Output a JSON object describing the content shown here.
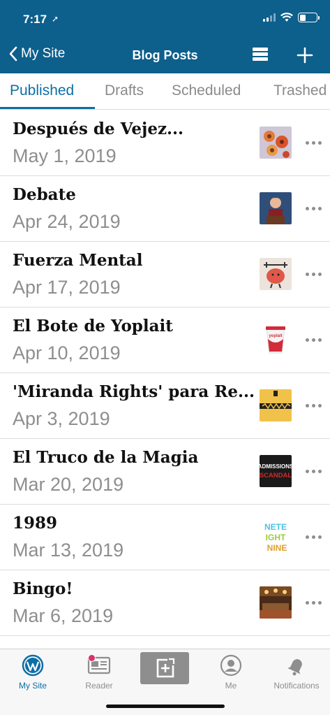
{
  "status_bar": {
    "time": "7:17"
  },
  "nav": {
    "back_label": "My Site",
    "title": "Blog Posts"
  },
  "tabs": [
    {
      "label": "Published"
    },
    {
      "label": "Drafts"
    },
    {
      "label": "Scheduled"
    },
    {
      "label": "Trashed"
    }
  ],
  "posts": [
    {
      "title": "Después de Vejez...",
      "date": "May 1, 2019"
    },
    {
      "title": "Debate",
      "date": "Apr 24, 2019"
    },
    {
      "title": "Fuerza Mental",
      "date": "Apr 17, 2019"
    },
    {
      "title": "El Bote de Yoplait",
      "date": "Apr 10, 2019"
    },
    {
      "title": "'Miranda Rights' para Re...",
      "date": "Apr 3, 2019"
    },
    {
      "title": "El Truco de la Magia",
      "date": "Mar 20, 2019"
    },
    {
      "title": "1989",
      "date": "Mar 13, 2019"
    },
    {
      "title": "Bingo!",
      "date": "Mar 6, 2019"
    }
  ],
  "thumbnails": {
    "post6_line1": "ADMISSIONS",
    "post6_line2": "SCANDAL",
    "post7_line1": "NETE",
    "post7_line2": "IGHT",
    "post7_line3": "NINE",
    "post4_brand": "yoplait"
  },
  "tabbar": {
    "items": [
      {
        "label": "My Site",
        "icon": "wordpress-icon"
      },
      {
        "label": "Reader",
        "icon": "reader-icon"
      },
      {
        "label": "",
        "icon": "new-post-icon"
      },
      {
        "label": "Me",
        "icon": "user-icon"
      },
      {
        "label": "Notifications",
        "icon": "bell-icon"
      }
    ]
  },
  "colors": {
    "brand": "#0d5f8c",
    "accent": "#0d6fa6",
    "muted": "#8e8e8e",
    "badge": "#d6336c"
  }
}
